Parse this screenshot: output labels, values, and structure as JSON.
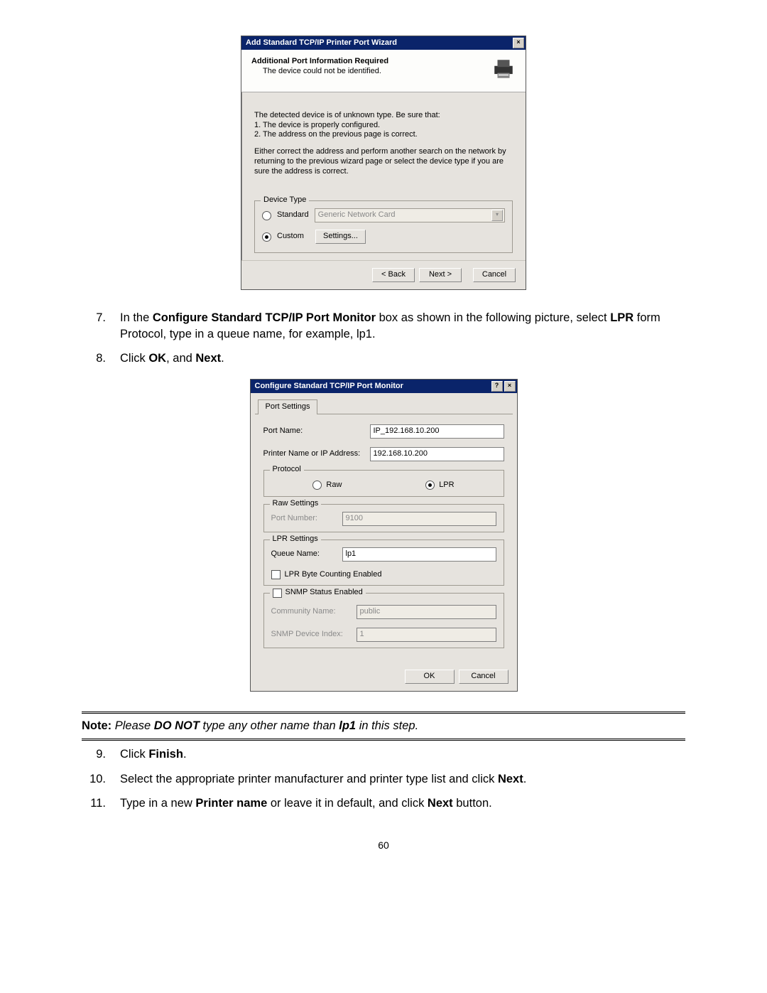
{
  "dlg1": {
    "title": "Add Standard TCP/IP Printer Port Wizard",
    "head_title": "Additional Port Information Required",
    "head_sub": "The device could not be identified.",
    "msg_intro": "The detected device is of unknown type.  Be sure that:",
    "msg_b1": "1.  The device is properly configured.",
    "msg_b2": "2.  The address on the previous page is correct.",
    "msg_para2": "Either correct the address and perform another search on the network by returning to the previous wizard page or select the device type if you are sure the address is correct.",
    "legend": "Device Type",
    "opt_standard": "Standard",
    "combo_value": "Generic Network Card",
    "opt_custom": "Custom",
    "btn_settings": "Settings...",
    "btn_back": "< Back",
    "btn_next": "Next >",
    "btn_cancel": "Cancel"
  },
  "list1": {
    "n7": "7.",
    "t7_pre": "In the ",
    "t7_bold1": "Configure Standard TCP/IP Port Monitor",
    "t7_mid": " box as shown in the following picture, select ",
    "t7_bold2": "LPR",
    "t7_post": " form Protocol, type in a queue name, for example, lp1.",
    "n8": "8.",
    "t8_pre": "Click ",
    "t8_bold1": "OK",
    "t8_mid": ", and ",
    "t8_bold2": "Next",
    "t8_post": "."
  },
  "dlg2": {
    "title": "Configure Standard TCP/IP Port Monitor",
    "tab": "Port Settings",
    "port_name_label": "Port Name:",
    "port_name_value": "IP_192.168.10.200",
    "ip_label": "Printer Name or IP Address:",
    "ip_value": "192.168.10.200",
    "legend_protocol": "Protocol",
    "opt_raw": "Raw",
    "opt_lpr": "LPR",
    "legend_raw": "Raw Settings",
    "raw_port_label": "Port Number:",
    "raw_port_value": "9100",
    "legend_lpr": "LPR Settings",
    "queue_label": "Queue Name:",
    "queue_value": "lp1",
    "lpr_byte": "LPR Byte Counting Enabled",
    "legend_snmp": "SNMP Status Enabled",
    "community_label": "Community Name:",
    "community_value": "public",
    "index_label": "SNMP Device Index:",
    "index_value": "1",
    "btn_ok": "OK",
    "btn_cancel": "Cancel"
  },
  "note": {
    "pre": "Note:",
    "mid1": " Please ",
    "donot": "DO NOT",
    "mid2": " type any other name than ",
    "lp1": "lp1",
    "post": " in this step."
  },
  "list2": {
    "n9": "9.",
    "t9_pre": "Click ",
    "t9_bold": "Finish",
    "t9_post": ".",
    "n10": "10.",
    "t10_pre": "Select the appropriate printer manufacturer and printer type list and click ",
    "t10_bold": "Next",
    "t10_post": ".",
    "n11": "11.",
    "t11_pre": "Type in a new ",
    "t11_bold1": "Printer name",
    "t11_mid": " or leave it in default, and click ",
    "t11_bold2": "Next",
    "t11_post": " button."
  },
  "page_number": "60"
}
